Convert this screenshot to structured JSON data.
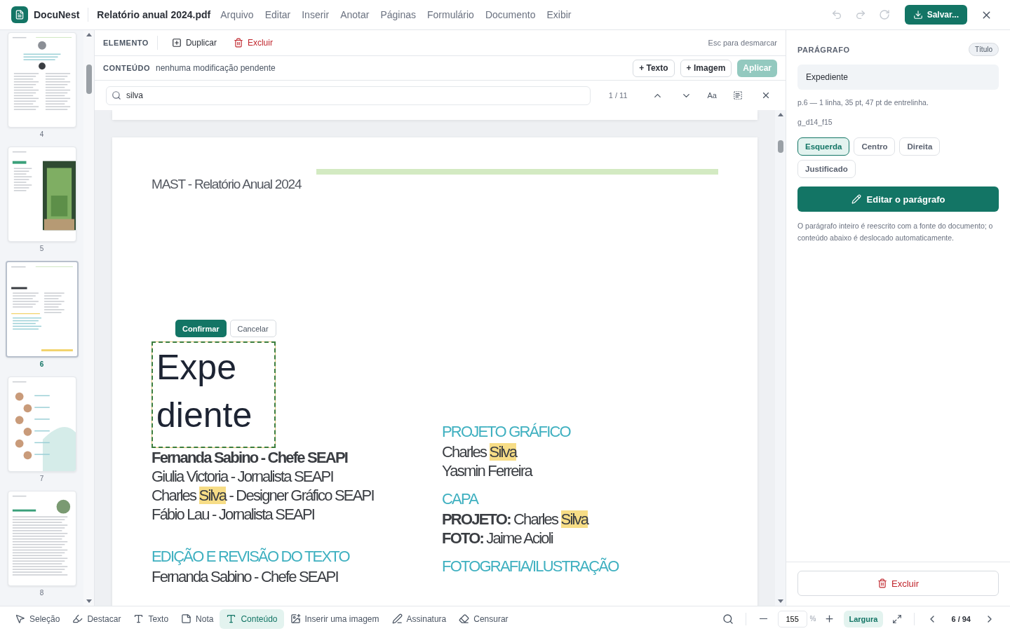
{
  "app": {
    "name": "DocuNest"
  },
  "document": {
    "filename": "Relatório anual 2024.pdf"
  },
  "menu": [
    "Arquivo",
    "Editar",
    "Inserir",
    "Anotar",
    "Páginas",
    "Formulário",
    "Documento",
    "Exibir"
  ],
  "history": [
    {
      "kind": "undo",
      "disabled": true
    },
    {
      "kind": "redo",
      "disabled": true
    },
    {
      "kind": "reload",
      "disabled": true
    }
  ],
  "save_button": "Salvar...",
  "element_bar": {
    "label": "ELEMENTO",
    "actions": [
      {
        "kind": "duplicate",
        "label": "Duplicar"
      },
      {
        "kind": "delete",
        "label": "Excluir"
      }
    ],
    "hint": "Esc para desmarcar"
  },
  "content_bar": {
    "label": "CONTEÚDO",
    "status": "nenhuma modificação pendente",
    "buttons": [
      {
        "kind": "outline",
        "label": "+ Texto",
        "disabled": false
      },
      {
        "kind": "outline",
        "label": "+ Imagem",
        "disabled": false
      },
      {
        "kind": "primary",
        "label": "Aplicar",
        "disabled": true
      }
    ]
  },
  "search": {
    "value": "silva",
    "count": "1 / 11",
    "case_label": "Aa"
  },
  "thumbnails": [
    {
      "page": "4",
      "kind": "text",
      "selected": false
    },
    {
      "page": "5",
      "kind": "index",
      "selected": false
    },
    {
      "page": "6",
      "kind": "list",
      "selected": true
    },
    {
      "page": "7",
      "kind": "people",
      "selected": false
    },
    {
      "page": "8",
      "kind": "letter",
      "selected": false
    }
  ],
  "page": {
    "header": "MAST - Relatório Anual 2024",
    "editor": {
      "value": "Expediente",
      "confirm": "Confirmar",
      "cancel": "Cancelar"
    },
    "columns": [
      [
        {
          "kind": "line",
          "segments": [
            {
              "text": "Fernanda Sabino - Chefe SEAPI",
              "bold": true,
              "match": false
            }
          ]
        },
        {
          "kind": "line",
          "segments": [
            {
              "text": "Giulia Victoria - Jornalista SEAPI",
              "bold": false,
              "match": false
            }
          ]
        },
        {
          "kind": "line",
          "segments": [
            {
              "text": "Charles ",
              "bold": false,
              "match": false
            },
            {
              "text": "Silva",
              "bold": false,
              "match": true
            },
            {
              "text": " - Designer Gráfico SEAPI",
              "bold": false,
              "match": false
            }
          ]
        },
        {
          "kind": "line",
          "segments": [
            {
              "text": "Fábio Lau - Jornalista SEAPI",
              "bold": false,
              "match": false
            }
          ]
        },
        {
          "kind": "heading",
          "text": "EDIÇÃO E REVISÃO DO TEXTO"
        },
        {
          "kind": "line",
          "segments": [
            {
              "text": "Fernanda Sabino - Chefe SEAPI",
              "bold": false,
              "match": false
            }
          ]
        }
      ],
      [
        {
          "kind": "heading",
          "text": "PROJETO GRÁFICO"
        },
        {
          "kind": "line",
          "segments": [
            {
              "text": "Charles ",
              "bold": false,
              "match": false
            },
            {
              "text": "Silva",
              "bold": false,
              "match": true
            }
          ]
        },
        {
          "kind": "line",
          "segments": [
            {
              "text": "Yasmin Ferreira",
              "bold": false,
              "match": false
            }
          ]
        },
        {
          "kind": "heading",
          "text": "CAPA"
        },
        {
          "kind": "line",
          "segments": [
            {
              "text": "PROJETO:",
              "bold": true,
              "match": false
            },
            {
              "text": " Charles ",
              "bold": false,
              "match": false
            },
            {
              "text": "Silva",
              "bold": false,
              "match": true
            }
          ]
        },
        {
          "kind": "line",
          "segments": [
            {
              "text": "FOTO:",
              "bold": true,
              "match": false
            },
            {
              "text": " Jaime Acioli",
              "bold": false,
              "match": false
            }
          ]
        },
        {
          "kind": "heading",
          "text": "FOTOGRAFIA/ILUSTRAÇÃO"
        }
      ]
    ]
  },
  "properties": {
    "title": "PARÁGRAFO",
    "tag": "Título",
    "text": "Expediente",
    "info": "p.6 — 1 linha, 35 pt, 47 pt de entrelinha.",
    "id": "g_d14_f15",
    "alignments": [
      {
        "label": "Esquerda",
        "selected": true
      },
      {
        "label": "Centro",
        "selected": false
      },
      {
        "label": "Direita",
        "selected": false
      },
      {
        "label": "Justificado",
        "selected": false
      }
    ],
    "edit_button": "Editar o parágrafo",
    "note": "O parágrafo inteiro é reescrito com a fonte do documento; o conteúdo abaixo é deslocado automaticamente.",
    "delete_button": "Excluir"
  },
  "tools": [
    {
      "kind": "select",
      "label": "Seleção",
      "selected": false
    },
    {
      "kind": "highlight",
      "label": "Destacar",
      "selected": false
    },
    {
      "kind": "text",
      "label": "Texto",
      "selected": false
    },
    {
      "kind": "note",
      "label": "Nota",
      "selected": false
    },
    {
      "kind": "content",
      "label": "Conteúdo",
      "selected": true
    },
    {
      "kind": "image",
      "label": "Inserir uma imagem",
      "selected": false
    },
    {
      "kind": "signature",
      "label": "Assinatura",
      "selected": false
    },
    {
      "kind": "redact",
      "label": "Censurar",
      "selected": false
    }
  ],
  "zoom": {
    "value": "155",
    "unit": "%",
    "fit": "Largura",
    "fit_selected": true
  },
  "pager": {
    "text": "6 / 94"
  }
}
